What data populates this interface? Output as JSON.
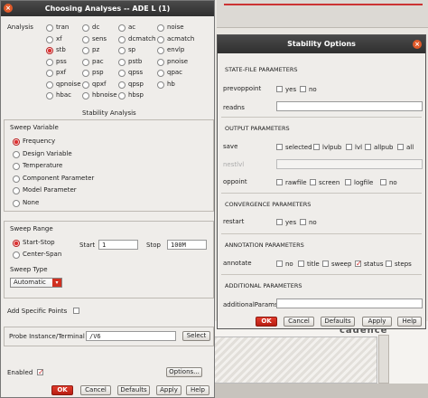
{
  "background": {
    "brand_text": "cadence"
  },
  "analyses_window": {
    "title": "Choosing Analyses -- ADE L (1)",
    "close_glyph": "×",
    "analysis_label": "Analysis",
    "analyses": [
      [
        "tran",
        "dc",
        "ac",
        "noise"
      ],
      [
        "xf",
        "sens",
        "dcmatch",
        "acmatch"
      ],
      [
        "stb",
        "pz",
        "sp",
        "envlp"
      ],
      [
        "pss",
        "pac",
        "pstb",
        "pnoise"
      ],
      [
        "pxf",
        "psp",
        "qpss",
        "qpac"
      ],
      [
        "qpnoise",
        "qpxf",
        "qpsp",
        "hb"
      ],
      [
        "hbac",
        "hbnoise",
        "hbsp",
        ""
      ]
    ],
    "selected_analysis": "stb",
    "section_title": "Stability Analysis",
    "sweep_variable": {
      "label": "Sweep Variable",
      "options": [
        "Frequency",
        "Design Variable",
        "Temperature",
        "Component Parameter",
        "Model Parameter",
        "None"
      ],
      "selected": "Frequency"
    },
    "sweep_range": {
      "label": "Sweep Range",
      "options": [
        "Start-Stop",
        "Center-Span"
      ],
      "selected": "Start-Stop",
      "start_label": "Start",
      "start_value": "1",
      "stop_label": "Stop",
      "stop_value": "100M"
    },
    "sweep_type": {
      "label": "Sweep Type",
      "value": "Automatic",
      "arrow": "▾"
    },
    "add_specific_points_label": "Add Specific Points",
    "probe_label": "Probe Instance/Terminal",
    "probe_value": "/V6",
    "select_button": "Select",
    "enabled_label": "Enabled",
    "enabled_checked": true,
    "options_button": "Options...",
    "buttons": [
      "OK",
      "Cancel",
      "Defaults",
      "Apply",
      "Help"
    ]
  },
  "stability_window": {
    "title": "Stability Options",
    "close_glyph": "×",
    "state_file_title": "STATE-FILE PARAMETERS",
    "prevoppoint_label": "prevoppoint",
    "prevoppoint_options": [
      "yes",
      "no"
    ],
    "readns_label": "readns",
    "output_title": "OUTPUT PARAMETERS",
    "save_label": "save",
    "save_options": [
      "selected",
      "lvlpub",
      "lvl",
      "allpub",
      "all"
    ],
    "nestlvl_label": "nestlvl",
    "oppoint_label": "oppoint",
    "oppoint_options": [
      "rawfile",
      "screen",
      "logfile",
      "no"
    ],
    "convergence_title": "CONVERGENCE PARAMETERS",
    "restart_label": "restart",
    "restart_options": [
      "yes",
      "no"
    ],
    "annotation_title": "ANNOTATION PARAMETERS",
    "annotate_label": "annotate",
    "annotate_options": [
      "no",
      "title",
      "sweep",
      "status",
      "steps"
    ],
    "annotate_checked": "status",
    "additional_title": "ADDITIONAL PARAMETERS",
    "additional_label": "additionalParams",
    "buttons": [
      "OK",
      "Cancel",
      "Defaults",
      "Apply",
      "Help"
    ]
  }
}
